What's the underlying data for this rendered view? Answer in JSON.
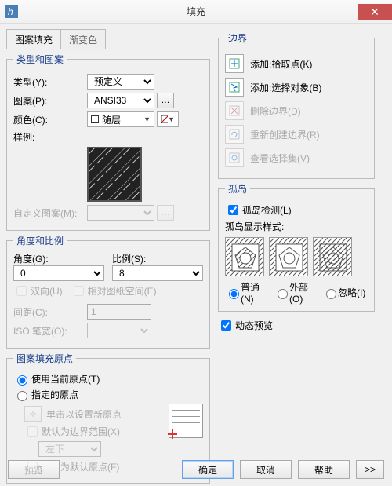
{
  "window": {
    "title": "填充"
  },
  "tabs": {
    "hatch": "图案填充",
    "gradient": "渐变色"
  },
  "group_type": {
    "legend": "类型和图案",
    "type_label": "类型(Y):",
    "type_value": "预定义",
    "pattern_label": "图案(P):",
    "pattern_value": "ANSI33",
    "color_label": "颜色(C):",
    "color_value": "随层",
    "sample_label": "样例:",
    "custom_label": "自定义图案(M):"
  },
  "group_angle": {
    "legend": "角度和比例",
    "angle_label": "角度(G):",
    "angle_value": "0",
    "scale_label": "比例(S):",
    "scale_value": "8",
    "double_label": "双向(U)",
    "relpaper_label": "相对图纸空间(E)",
    "spacing_label": "间距(C):",
    "spacing_value": "1",
    "isopen_label": "ISO 笔宽(O):"
  },
  "group_origin": {
    "legend": "图案填充原点",
    "use_current": "使用当前原点(T)",
    "specified": "指定的原点",
    "click_new": "单击以设置新原点",
    "default_extents": "默认为边界范围(X)",
    "pos_value": "左下",
    "store_default": "存储为默认原点(F)"
  },
  "group_boundary": {
    "legend": "边界",
    "add_pick": "添加:拾取点(K)",
    "add_select": "添加:选择对象(B)",
    "delete": "删除边界(D)",
    "recreate": "重新创建边界(R)",
    "view_sel": "查看选择集(V)"
  },
  "group_island": {
    "legend": "孤岛",
    "detect": "孤岛检测(L)",
    "style_label": "孤岛显示样式:",
    "opt_normal": "普通(N)",
    "opt_outer": "外部(O)",
    "opt_ignore": "忽略(I)"
  },
  "dyn_preview": "动态预览",
  "footer": {
    "preview": "预览",
    "ok": "确定",
    "cancel": "取消",
    "help": "帮助",
    "expand": ">>"
  }
}
